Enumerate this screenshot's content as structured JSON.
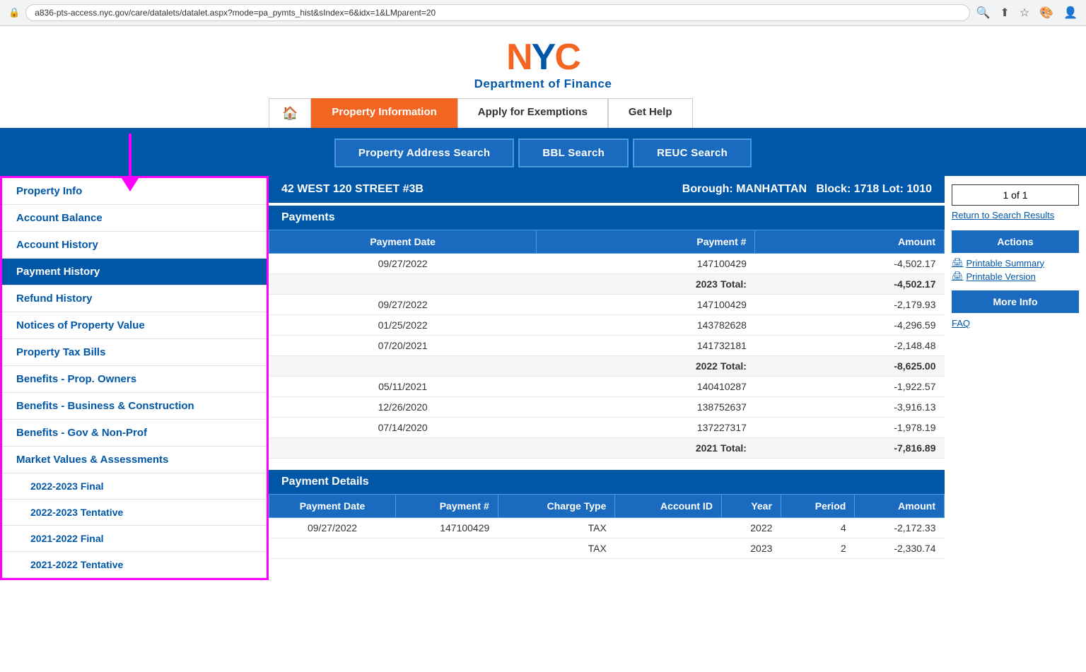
{
  "browser": {
    "url": "a836-pts-access.nyc.gov/care/datalets/datalet.aspx?mode=pa_pymts_hist&sIndex=6&idx=1&LMparent=20",
    "secure_icon": "🔒"
  },
  "header": {
    "logo": "NYC",
    "dept": "Department of Finance"
  },
  "nav": {
    "home_icon": "🏠",
    "tabs": [
      {
        "label": "Property Information",
        "active": true
      },
      {
        "label": "Apply for Exemptions",
        "active": false
      },
      {
        "label": "Get Help",
        "active": false
      }
    ]
  },
  "search_bar": {
    "buttons": [
      {
        "label": "Property Address Search"
      },
      {
        "label": "BBL Search"
      },
      {
        "label": "REUC Search"
      }
    ]
  },
  "sidebar": {
    "items": [
      {
        "label": "Property Info",
        "active": false,
        "sub": false
      },
      {
        "label": "Account Balance",
        "active": false,
        "sub": false
      },
      {
        "label": "Account History",
        "active": false,
        "sub": false
      },
      {
        "label": "Payment History",
        "active": true,
        "sub": false
      },
      {
        "label": "Refund History",
        "active": false,
        "sub": false
      },
      {
        "label": "Notices of Property Value",
        "active": false,
        "sub": false
      },
      {
        "label": "Property Tax Bills",
        "active": false,
        "sub": false
      },
      {
        "label": "Benefits - Prop. Owners",
        "active": false,
        "sub": false
      },
      {
        "label": "Benefits - Business & Construction",
        "active": false,
        "sub": false
      },
      {
        "label": "Benefits - Gov & Non-Prof",
        "active": false,
        "sub": false
      },
      {
        "label": "Market Values & Assessments",
        "active": false,
        "sub": false
      },
      {
        "label": "2022-2023 Final",
        "active": false,
        "sub": true
      },
      {
        "label": "2022-2023 Tentative",
        "active": false,
        "sub": true
      },
      {
        "label": "2021-2022 Final",
        "active": false,
        "sub": true
      },
      {
        "label": "2021-2022 Tentative",
        "active": false,
        "sub": true
      }
    ]
  },
  "property": {
    "address": "42 WEST 120 STREET #3B",
    "borough": "MANHATTAN",
    "block": "1718",
    "lot": "1010"
  },
  "payments_section": {
    "title": "Payments",
    "columns": [
      "Payment Date",
      "Payment #",
      "Amount"
    ],
    "rows": [
      {
        "date": "09/27/2022",
        "number": "147100429",
        "amount": "-4,502.17",
        "is_total": false
      },
      {
        "date": "",
        "number": "2023 Total:",
        "amount": "-4,502.17",
        "is_total": true
      },
      {
        "date": "09/27/2022",
        "number": "147100429",
        "amount": "-2,179.93",
        "is_total": false
      },
      {
        "date": "01/25/2022",
        "number": "143782628",
        "amount": "-4,296.59",
        "is_total": false
      },
      {
        "date": "07/20/2021",
        "number": "141732181",
        "amount": "-2,148.48",
        "is_total": false
      },
      {
        "date": "",
        "number": "2022 Total:",
        "amount": "-8,625.00",
        "is_total": true
      },
      {
        "date": "05/11/2021",
        "number": "140410287",
        "amount": "-1,922.57",
        "is_total": false
      },
      {
        "date": "12/26/2020",
        "number": "138752637",
        "amount": "-3,916.13",
        "is_total": false
      },
      {
        "date": "07/14/2020",
        "number": "137227317",
        "amount": "-1,978.19",
        "is_total": false
      },
      {
        "date": "",
        "number": "2021 Total:",
        "amount": "-7,816.89",
        "is_total": true
      }
    ]
  },
  "payment_details_section": {
    "title": "Payment Details",
    "columns": [
      "Payment Date",
      "Payment #",
      "Charge Type",
      "Account ID",
      "Year",
      "Period",
      "Amount"
    ],
    "rows": [
      {
        "date": "09/27/2022",
        "number": "147100429",
        "type": "TAX",
        "account": "",
        "year": "2022",
        "period": "4",
        "amount": "-2,172.33"
      },
      {
        "date": "",
        "number": "",
        "type": "TAX",
        "account": "",
        "year": "2023",
        "period": "2",
        "amount": "-2,330.74"
      }
    ]
  },
  "pagination": {
    "label": "1 of 1"
  },
  "right_panel": {
    "return_link": "Return to Search Results",
    "actions_label": "Actions",
    "printable_summary": "Printable Summary",
    "printable_version": "Printable Version",
    "more_info_label": "More Info",
    "faq_label": "FAQ"
  }
}
